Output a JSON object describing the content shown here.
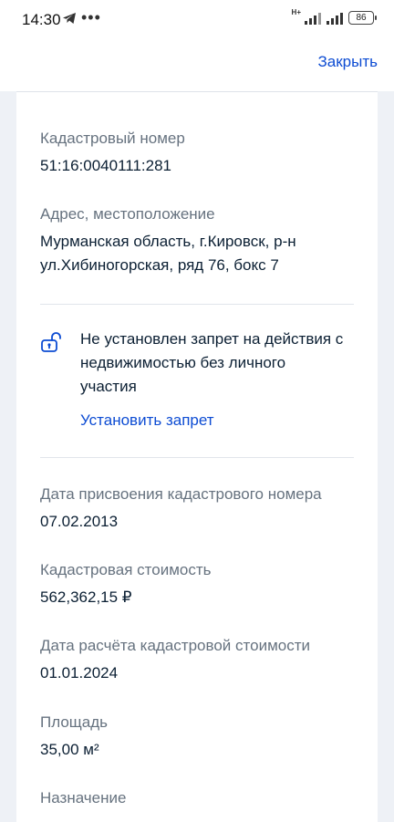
{
  "status_bar": {
    "time": "14:30",
    "network": "H+",
    "battery": "86",
    "icons": [
      "telegram-icon",
      "more-dots-icon",
      "signal-icon",
      "battery-icon"
    ]
  },
  "header": {
    "close_label": "Закрыть"
  },
  "fields": {
    "cadastral_number": {
      "label": "Кадастровый номер",
      "value": "51:16:0040111:281"
    },
    "address": {
      "label": "Адрес, местоположение",
      "value_line1": "Мурманская область, г.Кировск, р-н",
      "value_line2": "ул.Хибиногорская, ряд 76, бокс 7"
    },
    "restriction": {
      "text_line1": "Не установлен запрет на действия с",
      "text_line2": "недвижимостью без личного",
      "text_line3": "участия",
      "action_label": "Установить запрет"
    },
    "assignment_date": {
      "label": "Дата присвоения кадастрового номера",
      "value": "07.02.2013"
    },
    "cadastral_value": {
      "label": "Кадастровая стоимость",
      "value": "562,362,15 ₽"
    },
    "valuation_date": {
      "label": "Дата расчёта кадастровой стоимости",
      "value": "01.01.2024"
    },
    "area": {
      "label": "Площадь",
      "value": "35,00 м²"
    },
    "purpose": {
      "label": "Назначение"
    }
  },
  "colors": {
    "accent": "#0d4cd3",
    "text": "#0b1f33",
    "muted": "#66727f",
    "background": "#eef1f6"
  }
}
